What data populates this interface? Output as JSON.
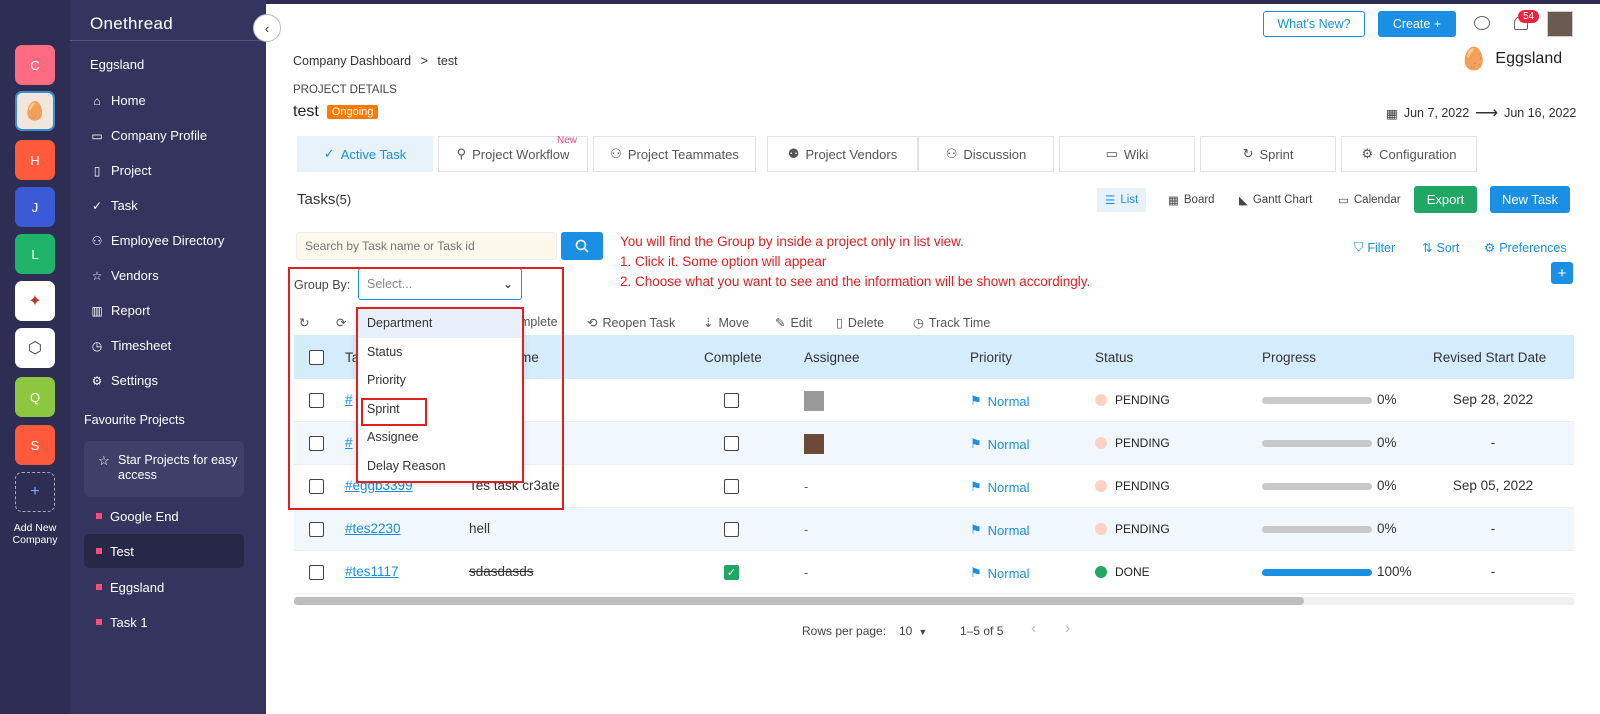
{
  "app": {
    "name": "Onethread"
  },
  "companies": {
    "items": [
      {
        "initial": "C",
        "color": "#ff6b81"
      },
      {
        "initial": "",
        "color": "#f0e6dc"
      },
      {
        "initial": "H",
        "color": "#ff5a3c"
      },
      {
        "initial": "J",
        "color": "#3b5bd6"
      },
      {
        "initial": "L",
        "color": "#1fb46a"
      },
      {
        "initial": "",
        "color": "#ffffff"
      },
      {
        "initial": "",
        "color": "#ffffff"
      },
      {
        "initial": "Q",
        "color": "#8dc63f"
      },
      {
        "initial": "S",
        "color": "#ff5a3c"
      }
    ],
    "add_label": "Add New Company"
  },
  "sidebar": {
    "workspace": "Eggsland",
    "items": [
      {
        "label": "Home",
        "icon": "home-icon"
      },
      {
        "label": "Company Profile",
        "icon": "briefcase-icon"
      },
      {
        "label": "Project",
        "icon": "document-icon"
      },
      {
        "label": "Task",
        "icon": "check-circle-icon"
      },
      {
        "label": "Employee Directory",
        "icon": "people-icon"
      },
      {
        "label": "Vendors",
        "icon": "star-icon"
      },
      {
        "label": "Report",
        "icon": "chart-icon"
      },
      {
        "label": "Timesheet",
        "icon": "clock-icon"
      },
      {
        "label": "Settings",
        "icon": "gear-icon"
      }
    ],
    "favourites_heading": "Favourite Projects",
    "star_tip": "Star Projects for easy access",
    "favourites": [
      {
        "label": "Google End"
      },
      {
        "label": "Test"
      },
      {
        "label": "Eggsland"
      },
      {
        "label": "Task 1"
      }
    ]
  },
  "topbar": {
    "whats_new": "What's New?",
    "create": "Create +",
    "notifications_count": "54"
  },
  "breadcrumb": {
    "root": "Company Dashboard",
    "sep": ">",
    "current": "test"
  },
  "project": {
    "section_label": "PROJECT DETAILS",
    "name": "test",
    "status": "Ongoing",
    "company": "Eggsland",
    "start_date": "Jun 7, 2022",
    "end_date": "Jun 16, 2022"
  },
  "tabs": [
    {
      "label": "Active Task",
      "icon": "check-circle-icon",
      "active": true
    },
    {
      "label": "Project Workflow",
      "icon": "workflow-icon",
      "badge": "New"
    },
    {
      "label": "Project Teammates",
      "icon": "people-icon"
    },
    {
      "label": "Project Vendors",
      "icon": "vendors-icon"
    },
    {
      "label": "Discussion",
      "icon": "discussion-icon"
    },
    {
      "label": "Wiki",
      "icon": "book-icon"
    },
    {
      "label": "Sprint",
      "icon": "sprint-icon"
    },
    {
      "label": "Configuration",
      "icon": "config-icon"
    }
  ],
  "tasks_header": {
    "title": "Tasks",
    "count": "(5)"
  },
  "views": [
    {
      "label": "List",
      "icon": "list-icon"
    },
    {
      "label": "Board",
      "icon": "board-icon"
    },
    {
      "label": "Gantt Chart",
      "icon": "gantt-icon"
    },
    {
      "label": "Calendar",
      "icon": "calendar-icon"
    }
  ],
  "buttons": {
    "export": "Export",
    "new_task": "New Task",
    "add": "+"
  },
  "search": {
    "placeholder": "Search by Task name or Task id"
  },
  "annotation": {
    "line1": "You will find the Group by inside a project only in list view.",
    "line2": "1. Click it. Some option will appear",
    "line3": "2. Choose what you want to see and the information will be shown accordingly."
  },
  "filters": {
    "filter": "Filter",
    "sort": "Sort",
    "preferences": "Preferences"
  },
  "group_by": {
    "label": "Group By:",
    "placeholder": "Select...",
    "options": [
      "Department",
      "Status",
      "Priority",
      "Sprint",
      "Assignee",
      "Delay Reason"
    ]
  },
  "actions": {
    "complete": "mplete",
    "reopen": "Reopen Task",
    "move": "Move",
    "edit": "Edit",
    "delete": "Delete",
    "track": "Track Time"
  },
  "table": {
    "headers": {
      "task": "Ta",
      "name": "me",
      "complete": "Complete",
      "assignee": "Assignee",
      "priority": "Priority",
      "status": "Status",
      "progress": "Progress",
      "revised": "Revised Start Date"
    },
    "rows": [
      {
        "id": "#",
        "name": "",
        "complete": false,
        "assignee": "avatar",
        "priority": "Normal",
        "status": "PENDING",
        "progress": 0,
        "progress_label": "0%",
        "revised": "Sep 28, 2022"
      },
      {
        "id": "#",
        "name": "",
        "complete": false,
        "assignee": "avatar",
        "priority": "Normal",
        "status": "PENDING",
        "progress": 0,
        "progress_label": "0%",
        "revised": "-"
      },
      {
        "id": "#eggb3399",
        "name": "Tes task cr3ate",
        "complete": false,
        "assignee": "-",
        "priority": "Normal",
        "status": "PENDING",
        "progress": 0,
        "progress_label": "0%",
        "revised": "Sep 05, 2022"
      },
      {
        "id": "#tes2230",
        "name": "hell",
        "complete": false,
        "assignee": "-",
        "priority": "Normal",
        "status": "PENDING",
        "progress": 0,
        "progress_label": "0%",
        "revised": "-"
      },
      {
        "id": "#tes1117",
        "name": "sdasdasds",
        "complete": true,
        "assignee": "-",
        "priority": "Normal",
        "status": "DONE",
        "progress": 100,
        "progress_label": "100%",
        "revised": "-"
      }
    ]
  },
  "pagination": {
    "rows_label": "Rows per page:",
    "rows_value": "10",
    "range": "1–5 of 5"
  }
}
